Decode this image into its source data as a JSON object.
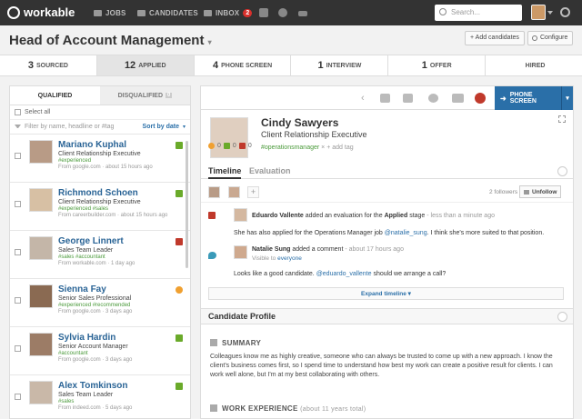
{
  "app": {
    "logo": "workable"
  },
  "nav": {
    "jobs": "JOBS",
    "candidates": "CANDIDATES",
    "inbox": "INBOX",
    "inbox_count": "2"
  },
  "search": {
    "placeholder": "Search..."
  },
  "header": {
    "title": "Head of Account Management",
    "add_candidates": "+ Add candidates",
    "configure": "Configure"
  },
  "stages": [
    {
      "count": "3",
      "label": "SOURCED"
    },
    {
      "count": "12",
      "label": "APPLIED"
    },
    {
      "count": "4",
      "label": "PHONE SCREEN"
    },
    {
      "count": "1",
      "label": "INTERVIEW"
    },
    {
      "count": "1",
      "label": "OFFER"
    },
    {
      "count": "",
      "label": "HIRED"
    }
  ],
  "left": {
    "tab_qualified": "QUALIFIED",
    "tab_disqualified": "DISQUALIFIED",
    "disqualified_count": "0",
    "select_all": "Select all",
    "filter_placeholder": "Filter by name, headline or #tag",
    "sort": "Sort by date",
    "candidates": [
      {
        "name": "Mariano Kuphal",
        "job": "Client Relationship Executive",
        "tags": "#experienced",
        "source": "From google.com · about 15 hours ago"
      },
      {
        "name": "Richmond Schoen",
        "job": "Client Relationship Executive",
        "tags": "#experienced #sales",
        "source": "From careerbuilder.com · about 15 hours ago"
      },
      {
        "name": "George Linnert",
        "job": "Sales Team Leader",
        "tags": "#sales #accountant",
        "source": "From workable.com · 1 day ago"
      },
      {
        "name": "Sienna Fay",
        "job": "Senior Sales Professional",
        "tags": "#experienced #recommended",
        "source": "From google.com · 3 days ago"
      },
      {
        "name": "Sylvia Hardin",
        "job": "Senior Account Manager",
        "tags": "#accountant",
        "source": "From google.com · 3 days ago"
      },
      {
        "name": "Alex Tomkinson",
        "job": "Sales Team Leader",
        "tags": "#sales",
        "source": "From indeed.com · 5 days ago"
      }
    ]
  },
  "profile": {
    "name": "Cindy Sawyers",
    "job": "Client Relationship Executive",
    "tag": "#operationsmanager",
    "add_tag": "+ add tag",
    "phone_screen": "PHONE SCREEN",
    "score_star": "0",
    "score_up": "0",
    "score_down": "0",
    "tab_timeline": "Timeline",
    "tab_evaluation": "Evaluation",
    "followers": "2 followers",
    "unfollow": "Unfollow"
  },
  "timeline": {
    "eval_author": "Eduardo Vallente",
    "eval_text": "added an evaluation for the",
    "eval_stage": "Applied",
    "eval_stage_suffix": "stage",
    "eval_time": "- less than a minute ago",
    "eval_body_pre": "She has also applied for the Operations Manager job",
    "eval_mention": "@natalie_sung",
    "eval_body_post": ". I think she's more suited to that position.",
    "comment_author": "Natalie Sung",
    "comment_text": "added a comment",
    "comment_time": "- about 17 hours ago",
    "visible_to": "Visible to",
    "visible_everyone": "everyone",
    "comment_body_pre": "Looks like a good candidate.",
    "comment_mention": "@eduardo_vallente",
    "comment_body_post": "should we arrange a call?",
    "expand": "Expand timeline ▾"
  },
  "candidate_profile": {
    "title": "Candidate Profile",
    "summary_heading": "SUMMARY",
    "summary": "Colleagues know me as highly creative, someone who can always be trusted to come up with a new approach. I know the client's business comes first, so I spend time to understand how best my work can create a positive result for clients. I can work well alone, but I'm at my best collaborating with others.",
    "work_heading": "WORK EXPERIENCE",
    "work_meta": "(about 11 years total)"
  }
}
